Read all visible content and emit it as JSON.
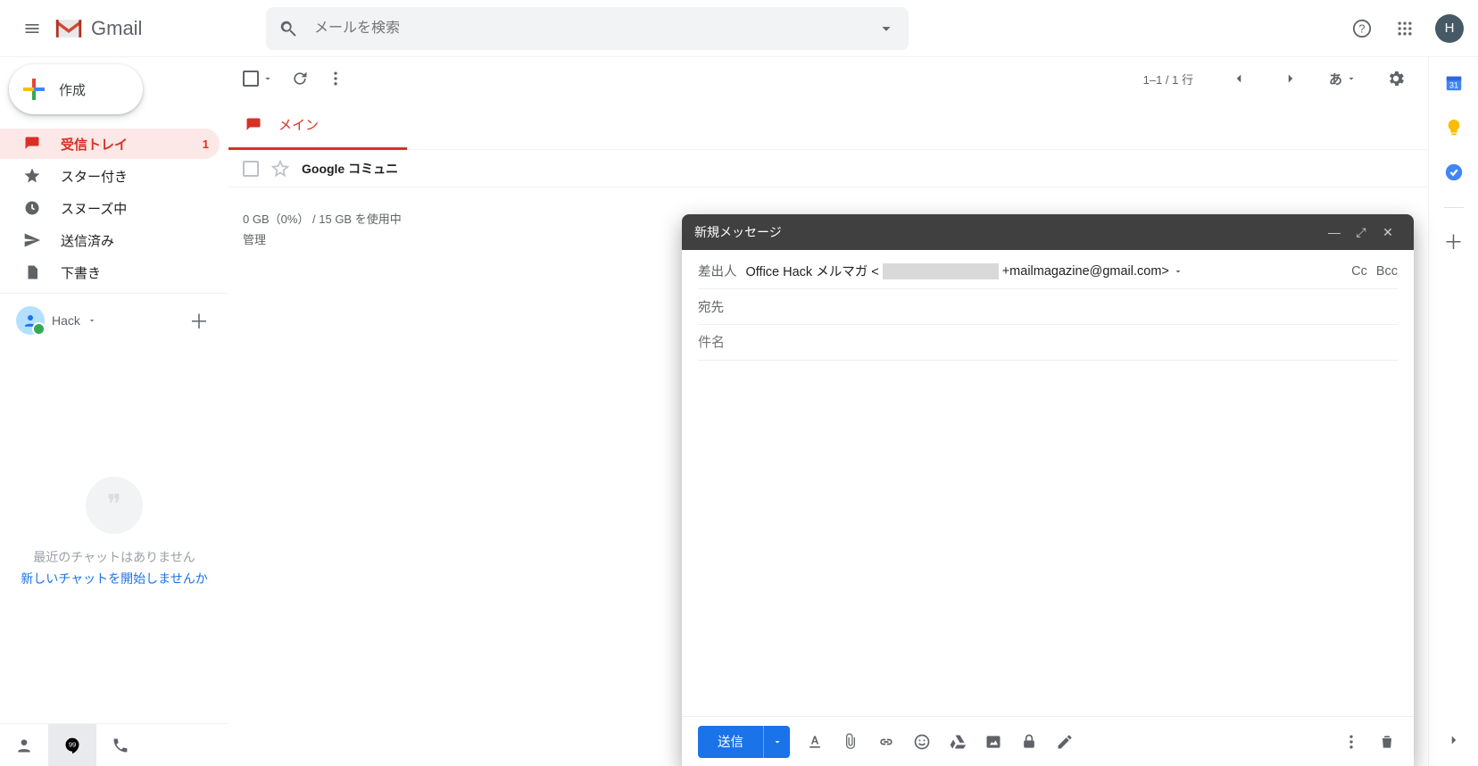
{
  "brand": "Gmail",
  "avatar_letter": "H",
  "search": {
    "placeholder": "メールを検索"
  },
  "compose_label": "作成",
  "lang_indicator": "あ",
  "nav": {
    "inbox": {
      "label": "受信トレイ",
      "count": "1"
    },
    "starred": {
      "label": "スター付き"
    },
    "snoozed": {
      "label": "スヌーズ中"
    },
    "sent": {
      "label": "送信済み"
    },
    "drafts": {
      "label": "下書き"
    }
  },
  "hangouts": {
    "name": "Hack"
  },
  "chat": {
    "empty1": "最近のチャットはありません",
    "empty2": "新しいチャットを開始しませんか"
  },
  "toolbar": {
    "pager": "1–1 / 1 行"
  },
  "tabs": {
    "primary": "メイン"
  },
  "mail": {
    "row1": {
      "sender": "Google コミュニ"
    }
  },
  "footer": {
    "line1": "0 GB（0%） / 15 GB を使用中",
    "line2": "管理"
  },
  "compose": {
    "title": "新規メッセージ",
    "from_label": "差出人",
    "from_prefix": "Office Hack メルマガ <",
    "from_suffix": "+mailmagazine@gmail.com>",
    "to_label": "宛先",
    "subject_placeholder": "件名",
    "cc": "Cc",
    "bcc": "Bcc",
    "send": "送信"
  },
  "right_rail": {
    "calendar_day": "31"
  }
}
